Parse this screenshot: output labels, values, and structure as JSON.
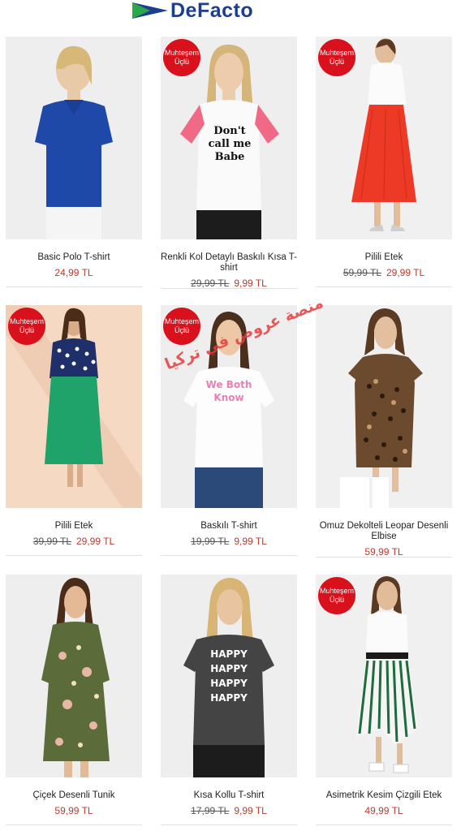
{
  "header": {
    "brand": "DeFacto"
  },
  "badge": {
    "line1": "Muhteşem",
    "line2": "Üçlü"
  },
  "products": [
    {
      "name": "Basic Polo T-shirt",
      "old_price": "",
      "price": "24,99 TL",
      "badge": false
    },
    {
      "name": "Renkli Kol Detaylı Baskılı Kısa T-shirt",
      "old_price": "29,99 TL",
      "price": "9,99 TL",
      "badge": true,
      "print_text": "Don't call me Babe"
    },
    {
      "name": "Pilili Etek",
      "old_price": "59,99 TL",
      "price": "29,99 TL",
      "badge": true
    },
    {
      "name": "Pilili Etek",
      "old_price": "39,99 TL",
      "price": "29,99 TL",
      "badge": true
    },
    {
      "name": "Baskılı T-shirt",
      "old_price": "19,99 TL",
      "price": "9,99 TL",
      "badge": true,
      "print_text": "We Both Know"
    },
    {
      "name": "Omuz Dekolteli Leopar Desenli Elbise",
      "old_price": "",
      "price": "59,99 TL",
      "badge": false
    },
    {
      "name": "Çiçek Desenli Tunik",
      "old_price": "",
      "price": "59,99 TL",
      "badge": false
    },
    {
      "name": "Kısa Kollu T-shirt",
      "old_price": "17,99 TL",
      "price": "9,99 TL",
      "badge": false,
      "print_text": "HAPPY"
    },
    {
      "name": "Asimetrik Kesim Çizgili Etek",
      "old_price": "",
      "price": "49,99 TL",
      "badge": true
    }
  ],
  "watermark": "منصة عروض في تركيا",
  "colors": {
    "brand": "#1d3e8c",
    "badge": "#d9111d",
    "price": "#c0392b"
  }
}
